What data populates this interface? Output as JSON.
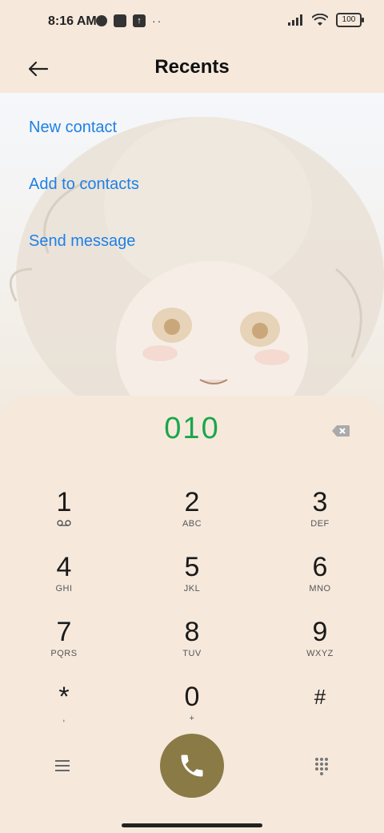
{
  "status": {
    "time": "8:16 AM",
    "battery": "100"
  },
  "header": {
    "title": "Recents"
  },
  "menu": {
    "items": [
      {
        "label": "New contact"
      },
      {
        "label": "Add to contacts"
      },
      {
        "label": "Send message"
      }
    ]
  },
  "dialer": {
    "number": "010"
  },
  "keys": [
    {
      "digit": "1",
      "letters": ""
    },
    {
      "digit": "2",
      "letters": "ABC"
    },
    {
      "digit": "3",
      "letters": "DEF"
    },
    {
      "digit": "4",
      "letters": "GHI"
    },
    {
      "digit": "5",
      "letters": "JKL"
    },
    {
      "digit": "6",
      "letters": "MNO"
    },
    {
      "digit": "7",
      "letters": "PQRS"
    },
    {
      "digit": "8",
      "letters": "TUV"
    },
    {
      "digit": "9",
      "letters": "WXYZ"
    },
    {
      "digit": "*",
      "letters": ","
    },
    {
      "digit": "0",
      "letters": "+"
    },
    {
      "digit": "#",
      "letters": ""
    }
  ],
  "icons": {
    "back": "arrow-left-icon",
    "backspace": "backspace-icon",
    "call": "phone-icon",
    "menu": "hamburger-menu-icon",
    "keypad": "dialpad-grid-icon",
    "voicemail": "voicemail-icon"
  },
  "colors": {
    "accent_link": "#1e80e6",
    "number": "#1aa64a",
    "call_button": "#8a7a45",
    "background": "#f6e9dc"
  }
}
